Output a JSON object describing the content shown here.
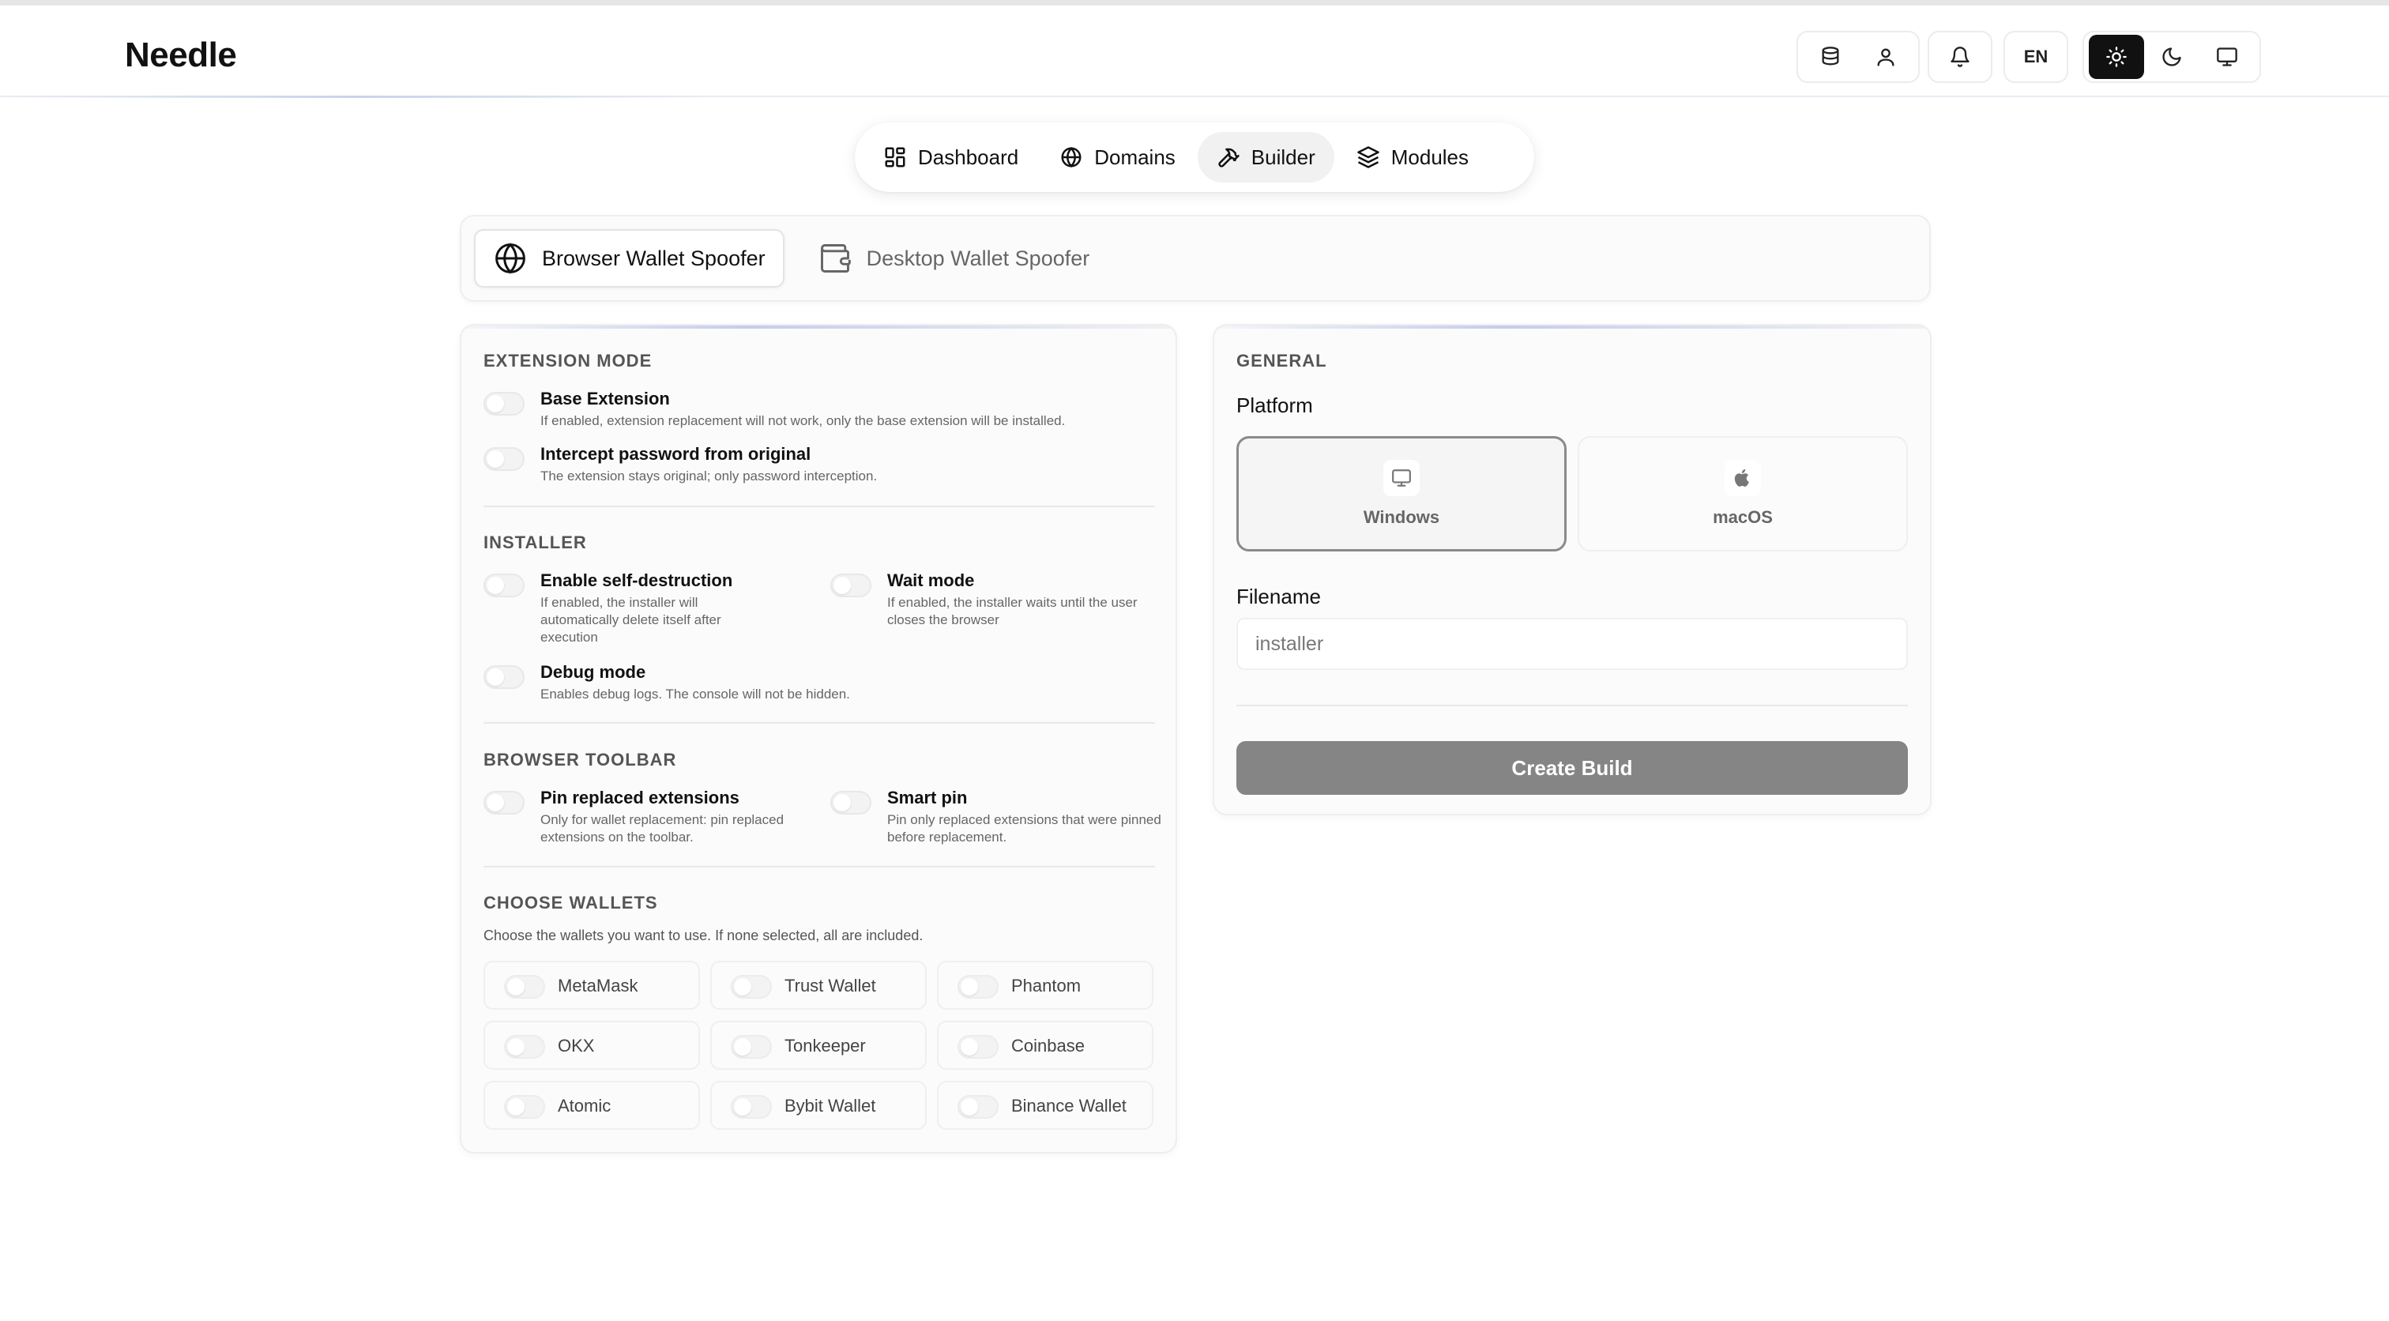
{
  "brand": "Needle",
  "header": {
    "lang": "EN"
  },
  "nav": [
    {
      "label": "Dashboard",
      "icon": "dashboard-grid-icon"
    },
    {
      "label": "Domains",
      "icon": "globe-icon"
    },
    {
      "label": "Builder",
      "icon": "hammer-icon",
      "active": true
    },
    {
      "label": "Modules",
      "icon": "layers-icon"
    }
  ],
  "tabs": [
    {
      "label": "Browser Wallet Spoofer",
      "icon": "globe-icon",
      "active": true
    },
    {
      "label": "Desktop Wallet Spoofer",
      "icon": "wallet-icon"
    }
  ],
  "left": {
    "extension_mode": {
      "title": "EXTENSION MODE",
      "base_extension": {
        "label": "Base Extension",
        "desc": "If enabled, extension replacement will not work, only the base extension will be installed."
      },
      "intercept": {
        "label": "Intercept password from original",
        "desc": "The extension stays original; only password interception."
      }
    },
    "installer": {
      "title": "INSTALLER",
      "self_destruct": {
        "label": "Enable self-destruction",
        "desc": "If enabled, the installer will automatically delete itself after execution"
      },
      "wait_mode": {
        "label": "Wait mode",
        "desc": "If enabled, the installer waits until the user closes the browser"
      },
      "debug_mode": {
        "label": "Debug mode",
        "desc": "Enables debug logs. The console will not be hidden."
      }
    },
    "toolbar": {
      "title": "BROWSER TOOLBAR",
      "pin_replaced": {
        "label": "Pin replaced extensions",
        "desc": "Only for wallet replacement: pin replaced extensions on the toolbar."
      },
      "smart_pin": {
        "label": "Smart pin",
        "desc": "Pin only replaced extensions that were pinned before replacement."
      }
    },
    "wallets": {
      "title": "CHOOSE WALLETS",
      "desc": "Choose the wallets you want to use. If none selected, all are included.",
      "items": [
        "MetaMask",
        "Trust Wallet",
        "Phantom",
        "OKX",
        "Tonkeeper",
        "Coinbase",
        "Atomic",
        "Bybit Wallet",
        "Binance Wallet"
      ]
    }
  },
  "right": {
    "title": "GENERAL",
    "platform_label": "Platform",
    "platforms": [
      {
        "label": "Windows",
        "icon": "monitor-icon",
        "selected": true
      },
      {
        "label": "macOS",
        "icon": "apple-icon",
        "selected": false
      }
    ],
    "filename_label": "Filename",
    "filename_placeholder": "installer",
    "filename_value": "",
    "build_button": "Create Build"
  }
}
